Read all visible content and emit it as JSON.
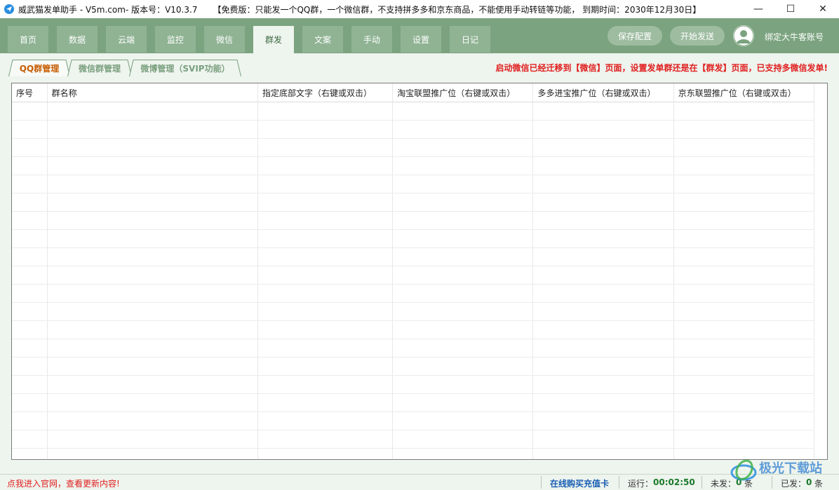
{
  "window": {
    "title": "威武猫发单助手 - V5m.com- 版本号：V10.3.7",
    "notice": "【免费版：只能发一个QQ群，一个微信群，不支持拼多多和京东商品，不能使用手动转链等功能， 到期时间：2030年12月30日】",
    "controls": {
      "minimize": "—",
      "maximize": "☐",
      "close": "✕"
    }
  },
  "nav": {
    "tabs": [
      "首页",
      "数据",
      "云端",
      "监控",
      "微信",
      "群发",
      "文案",
      "手动",
      "设置",
      "日记"
    ],
    "active_tab": "群发",
    "save_button": "保存配置",
    "start_button": "开始发送",
    "bind_account": "绑定大牛客账号"
  },
  "subtabs": {
    "items": [
      "QQ群管理",
      "微信群管理",
      "微博管理（SVIP功能）"
    ],
    "active": "QQ群管理"
  },
  "red_notice": "启动微信已经迁移到【微信】页面，设置发单群还是在【群发】页面，已支持多微信发单!",
  "table": {
    "columns": [
      "序号",
      "群名称",
      "指定底部文字（右键或双击）",
      "淘宝联盟推广位（右键或双击）",
      "多多进宝推广位（右键或双击）",
      "京东联盟推广位（右键或双击）"
    ],
    "rows": []
  },
  "status": {
    "website_link": "点我进入官网，查看更新内容!",
    "buy_card": "在线购买充值卡",
    "running_label": "运行：",
    "running_time": "00:02:50",
    "unsent_label": "未发：",
    "unsent_count": "0",
    "unsent_unit": "条",
    "sent_label": "已发：",
    "sent_count": "0",
    "sent_unit": "条"
  },
  "watermark": "极光下载站",
  "colors": {
    "nav_green": "#7ba37f",
    "content_bg": "#eef4ee",
    "active_subtab_text": "#c75c00",
    "notice_red": "#e02020",
    "status_link_red": "#e02020",
    "buy_card_blue": "#1a5fb4"
  }
}
